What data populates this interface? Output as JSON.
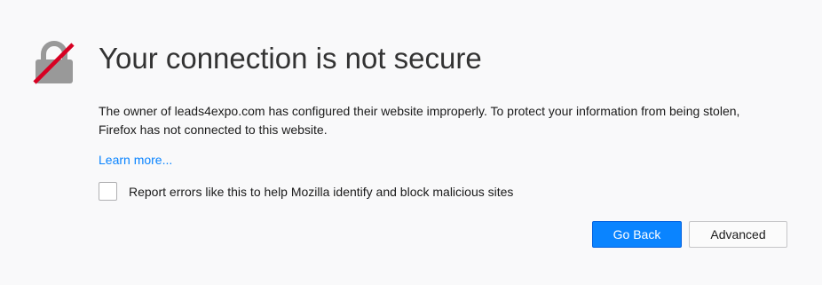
{
  "page": {
    "title": "Your connection is not secure",
    "description": "The owner of leads4expo.com has configured their website improperly. To protect your information from being stolen, Firefox has not connected to this website.",
    "learn_more": "Learn more...",
    "report_checkbox_label": "Report errors like this to help Mozilla identify and block malicious sites",
    "report_checkbox_checked": false
  },
  "buttons": {
    "go_back": "Go Back",
    "advanced": "Advanced"
  },
  "icons": {
    "warning": "broken-lock-icon"
  },
  "colors": {
    "background": "#f9f9fa",
    "accent": "#0a84ff",
    "lock_gray": "#999999",
    "strike_red": "#d70022"
  }
}
